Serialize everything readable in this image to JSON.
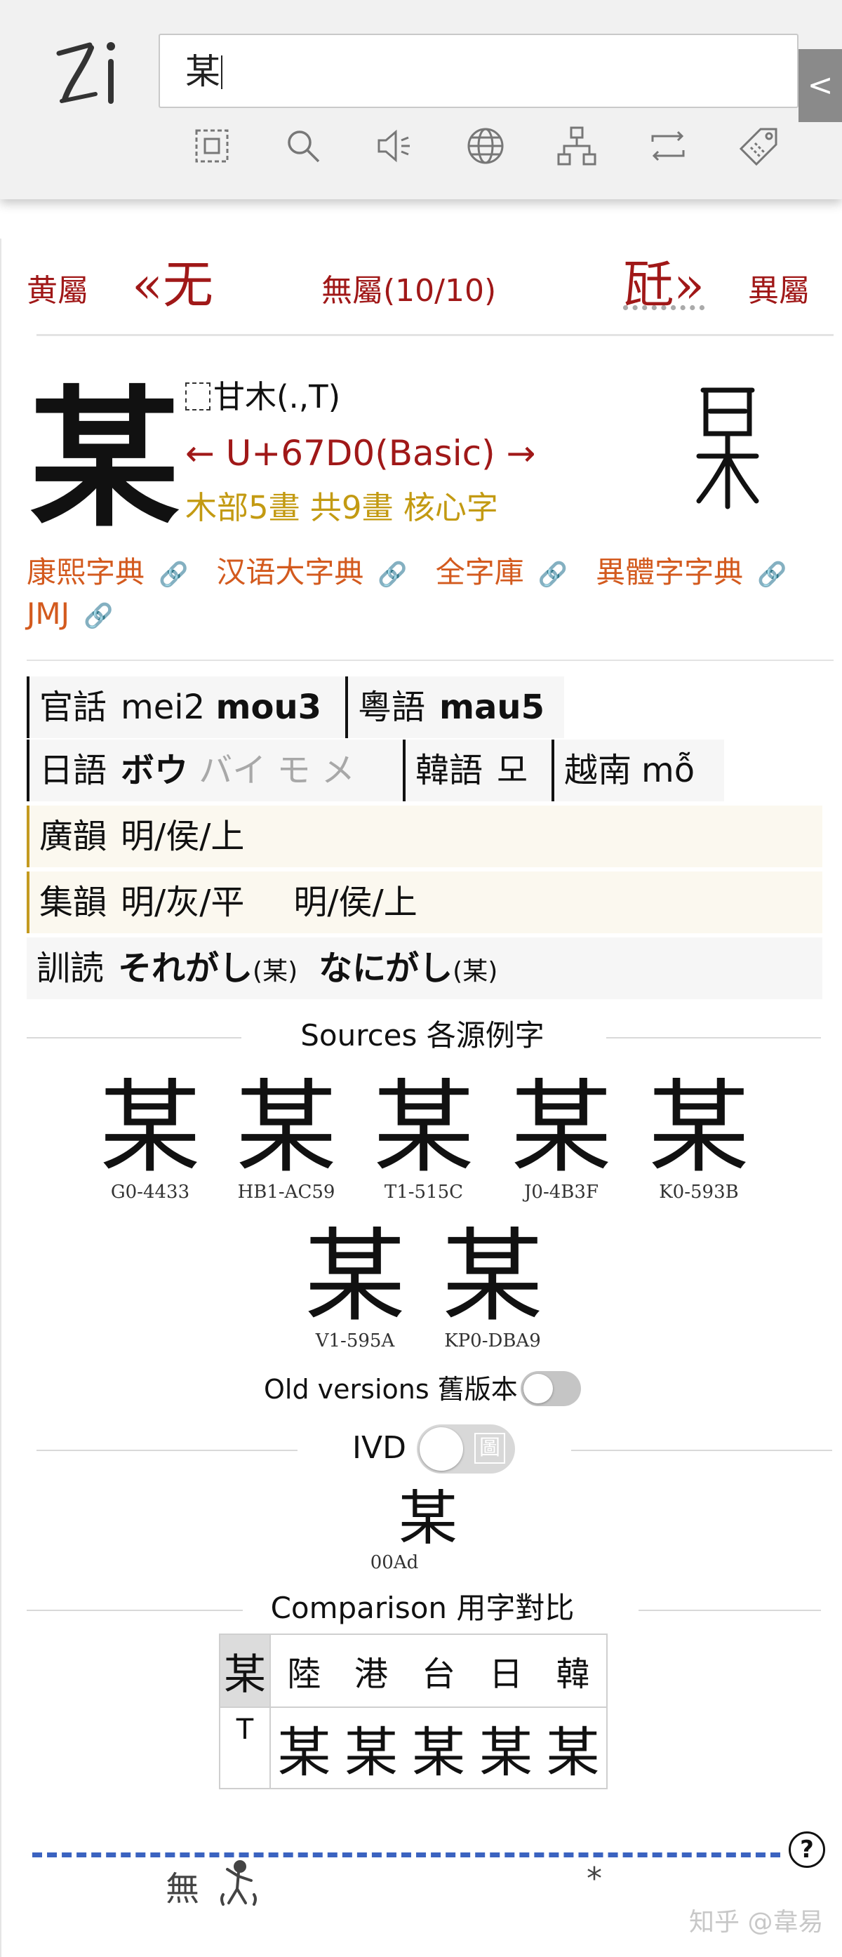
{
  "header": {
    "logo": "Zi",
    "search_value": "某",
    "collapse_label": "<",
    "tools": [
      "select-region-icon",
      "search-icon",
      "speaker-icon",
      "globe-icon",
      "hierarchy-icon",
      "swap-icon",
      "tag-icon"
    ]
  },
  "nav": {
    "prev_radical": "黄屬",
    "prev_char": "«无",
    "current": "無屬(10/10)",
    "next_char": "瓩»",
    "next_radical": "異屬"
  },
  "char": {
    "glyph": "某",
    "ids": "甘木(.,T)",
    "codepoint": "← U+67D0(Basic) →",
    "strokes": "木部5畫 共9畫 核心字",
    "seal_icon": "seal-script-icon"
  },
  "dictionaries": [
    "康熙字典",
    "汉语大字典",
    "全字庫",
    "異體字字典",
    "JMJ"
  ],
  "readings": {
    "mandarin_label": "官話",
    "mandarin_1": "mei2",
    "mandarin_2": "mou3",
    "cantonese_label": "粵語",
    "cantonese": "mau5",
    "japanese_label": "日語",
    "japanese_main": "ボウ",
    "japanese_other": "バイ モ メ",
    "korean_label": "韓語",
    "korean": "모",
    "vietnamese_label": "越南",
    "vietnamese": "mỗ",
    "guangyun_label": "廣韻",
    "guangyun": "明/侯/上",
    "jiyun_label": "集韻",
    "jiyun_1": "明/灰/平",
    "jiyun_2": "明/侯/上",
    "kundoku_label": "訓読",
    "kundoku_1": "それがし",
    "kundoku_1_note": "(某)",
    "kundoku_2": "なにがし",
    "kundoku_2_note": "(某)"
  },
  "sources": {
    "title": "Sources 各源例字",
    "items": [
      {
        "glyph": "某",
        "code": "G0-4433"
      },
      {
        "glyph": "某",
        "code": "HB1-AC59"
      },
      {
        "glyph": "某",
        "code": "T1-515C"
      },
      {
        "glyph": "某",
        "code": "J0-4B3F"
      },
      {
        "glyph": "某",
        "code": "K0-593B"
      },
      {
        "glyph": "某",
        "code": "V1-595A"
      },
      {
        "glyph": "某",
        "code": "KP0-DBA9"
      }
    ],
    "old_versions_label": "Old versions 舊版本"
  },
  "ivd": {
    "label": "IVD",
    "toggle_tag": "圖",
    "glyph": "某",
    "code": "00Ad"
  },
  "comparison": {
    "title": "Comparison 用字對比",
    "corner": "某",
    "headers": [
      "陸",
      "港",
      "台",
      "日",
      "韓"
    ],
    "row_label": "T",
    "cells": [
      "某",
      "某",
      "某",
      "某",
      "某"
    ]
  },
  "footer": {
    "help": "?",
    "bottom_char": "無",
    "asterisk": "*",
    "watermark": "知乎 @韋易"
  }
}
